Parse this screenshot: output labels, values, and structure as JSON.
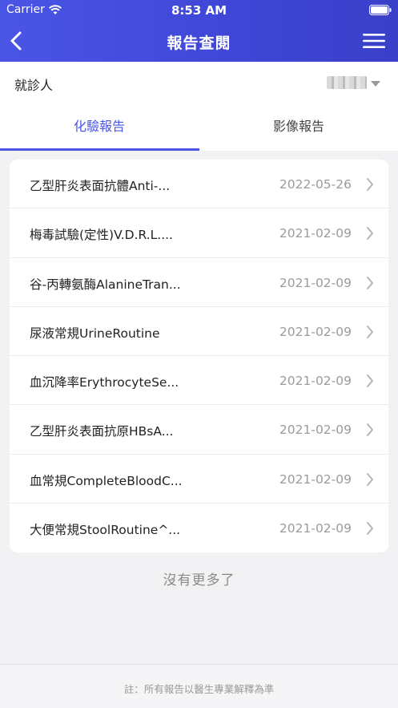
{
  "status_bar": {
    "carrier": "Carrier",
    "time": "8:53 AM"
  },
  "navbar": {
    "title": "報告查閱"
  },
  "patient": {
    "label": "就診人"
  },
  "tabs": [
    {
      "label": "化驗報告",
      "active": true
    },
    {
      "label": "影像報告",
      "active": false
    }
  ],
  "reports": [
    {
      "name": "乙型肝炎表面抗體Anti-...",
      "date": "2022-05-26"
    },
    {
      "name": "梅毒試驗(定性)V.D.R.L....",
      "date": "2021-02-09"
    },
    {
      "name": "谷-丙轉氨酶AlanineTran...",
      "date": "2021-02-09"
    },
    {
      "name": "尿液常規UrineRoutine",
      "date": "2021-02-09"
    },
    {
      "name": "血沉降率ErythrocyteSe...",
      "date": "2021-02-09"
    },
    {
      "name": "乙型肝炎表面抗原HBsA...",
      "date": "2021-02-09"
    },
    {
      "name": "血常規CompleteBloodC...",
      "date": "2021-02-09"
    },
    {
      "name": "大便常規StoolRoutine^...",
      "date": "2021-02-09"
    }
  ],
  "no_more_text": "沒有更多了",
  "footer_note": "註：所有報告以醫生專業解釋為準",
  "colors": {
    "accent": "#4a55e6",
    "header_gradient_end": "#3a40c9",
    "date_gray": "#9b9b9b"
  }
}
